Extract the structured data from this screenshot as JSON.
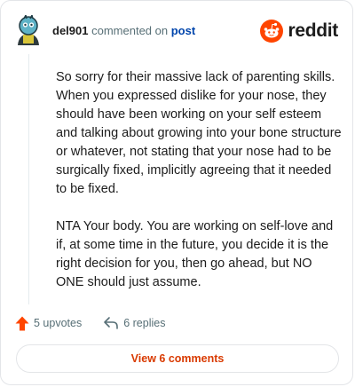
{
  "comment": {
    "username": "del901",
    "commented_text": "commented on",
    "post_link": "post",
    "paragraphs": [
      "So sorry for their massive lack of parenting skills. When you expressed dislike for your nose, they should have been working on your self esteem and talking about growing into your bone structure or whatever, not stating that your nose had to be surgically fixed, implicitly agreeing that it needed to be fixed.",
      "NTA Your body. You are working on self-love and if, at some time in the future, you decide it is the right decision for you, then go ahead, but NO ONE should just assume."
    ]
  },
  "brand": {
    "wordmark": "reddit",
    "color": "#ff4500"
  },
  "actions": {
    "upvotes_label": "5 upvotes",
    "replies_label": "6 replies",
    "upvote_icon": "upvote-arrow-icon",
    "reply_icon": "reply-arrow-icon"
  },
  "footer": {
    "view_comments_label": "View 6 comments",
    "accent": "#d93a00"
  }
}
